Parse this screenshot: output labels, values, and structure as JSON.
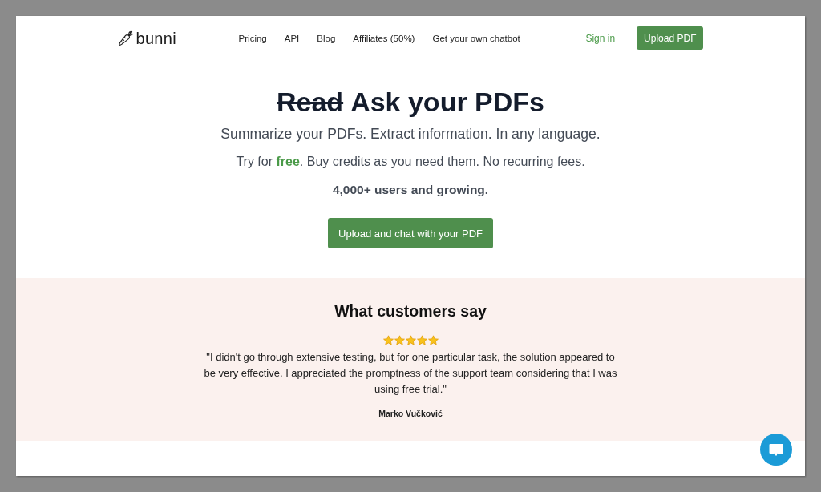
{
  "nav": {
    "logo": "bunni",
    "links": [
      "Pricing",
      "API",
      "Blog",
      "Affiliates (50%)",
      "Get your own chatbot"
    ],
    "sign_in": "Sign in",
    "upload_button": "Upload PDF"
  },
  "hero": {
    "title": [
      {
        "text": "Read",
        "struck": true
      },
      {
        "text": "Ask your PDFs",
        "struck": false
      }
    ],
    "subtitle": "Summarize your PDFs. Extract information. In any language.",
    "offer": "Try for **free**. Buy credits as you need them. No recurring fees.",
    "users": "4,000+ users and growing.",
    "button": "Upload and chat with your PDF"
  },
  "testimonials": {
    "title": "What customers say",
    "reviews": [
      {
        "stars": 5,
        "quote": "\"I didn't go through extensive testing, but for one particular task, the solution appeared to be very effective. I appreciated the promptness of the support team considering that I was using free trial.\"",
        "author": "Marko Vučković"
      }
    ]
  }
}
